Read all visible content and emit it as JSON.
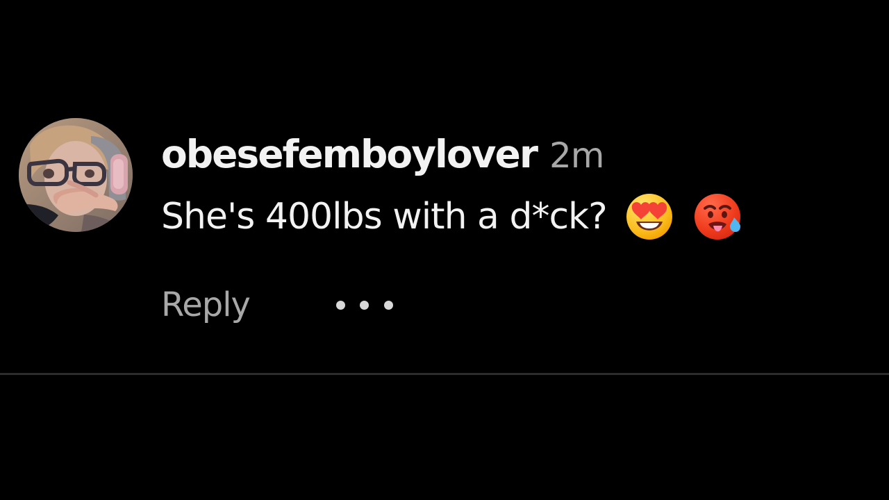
{
  "comment": {
    "avatar_label": "user avatar",
    "username": "obesefemboylover",
    "time": "2m",
    "text": "She's 400lbs with a d*ck?",
    "emojis": [
      "heart-eyes-emoji",
      "hot-face-emoji"
    ],
    "reply_label": "Reply",
    "more_icon": "more-options-icon"
  },
  "colors": {
    "background": "#000000",
    "primary_text": "#f2f2f2",
    "secondary_text": "#a8a8a8",
    "divider": "#2c2c2c"
  }
}
